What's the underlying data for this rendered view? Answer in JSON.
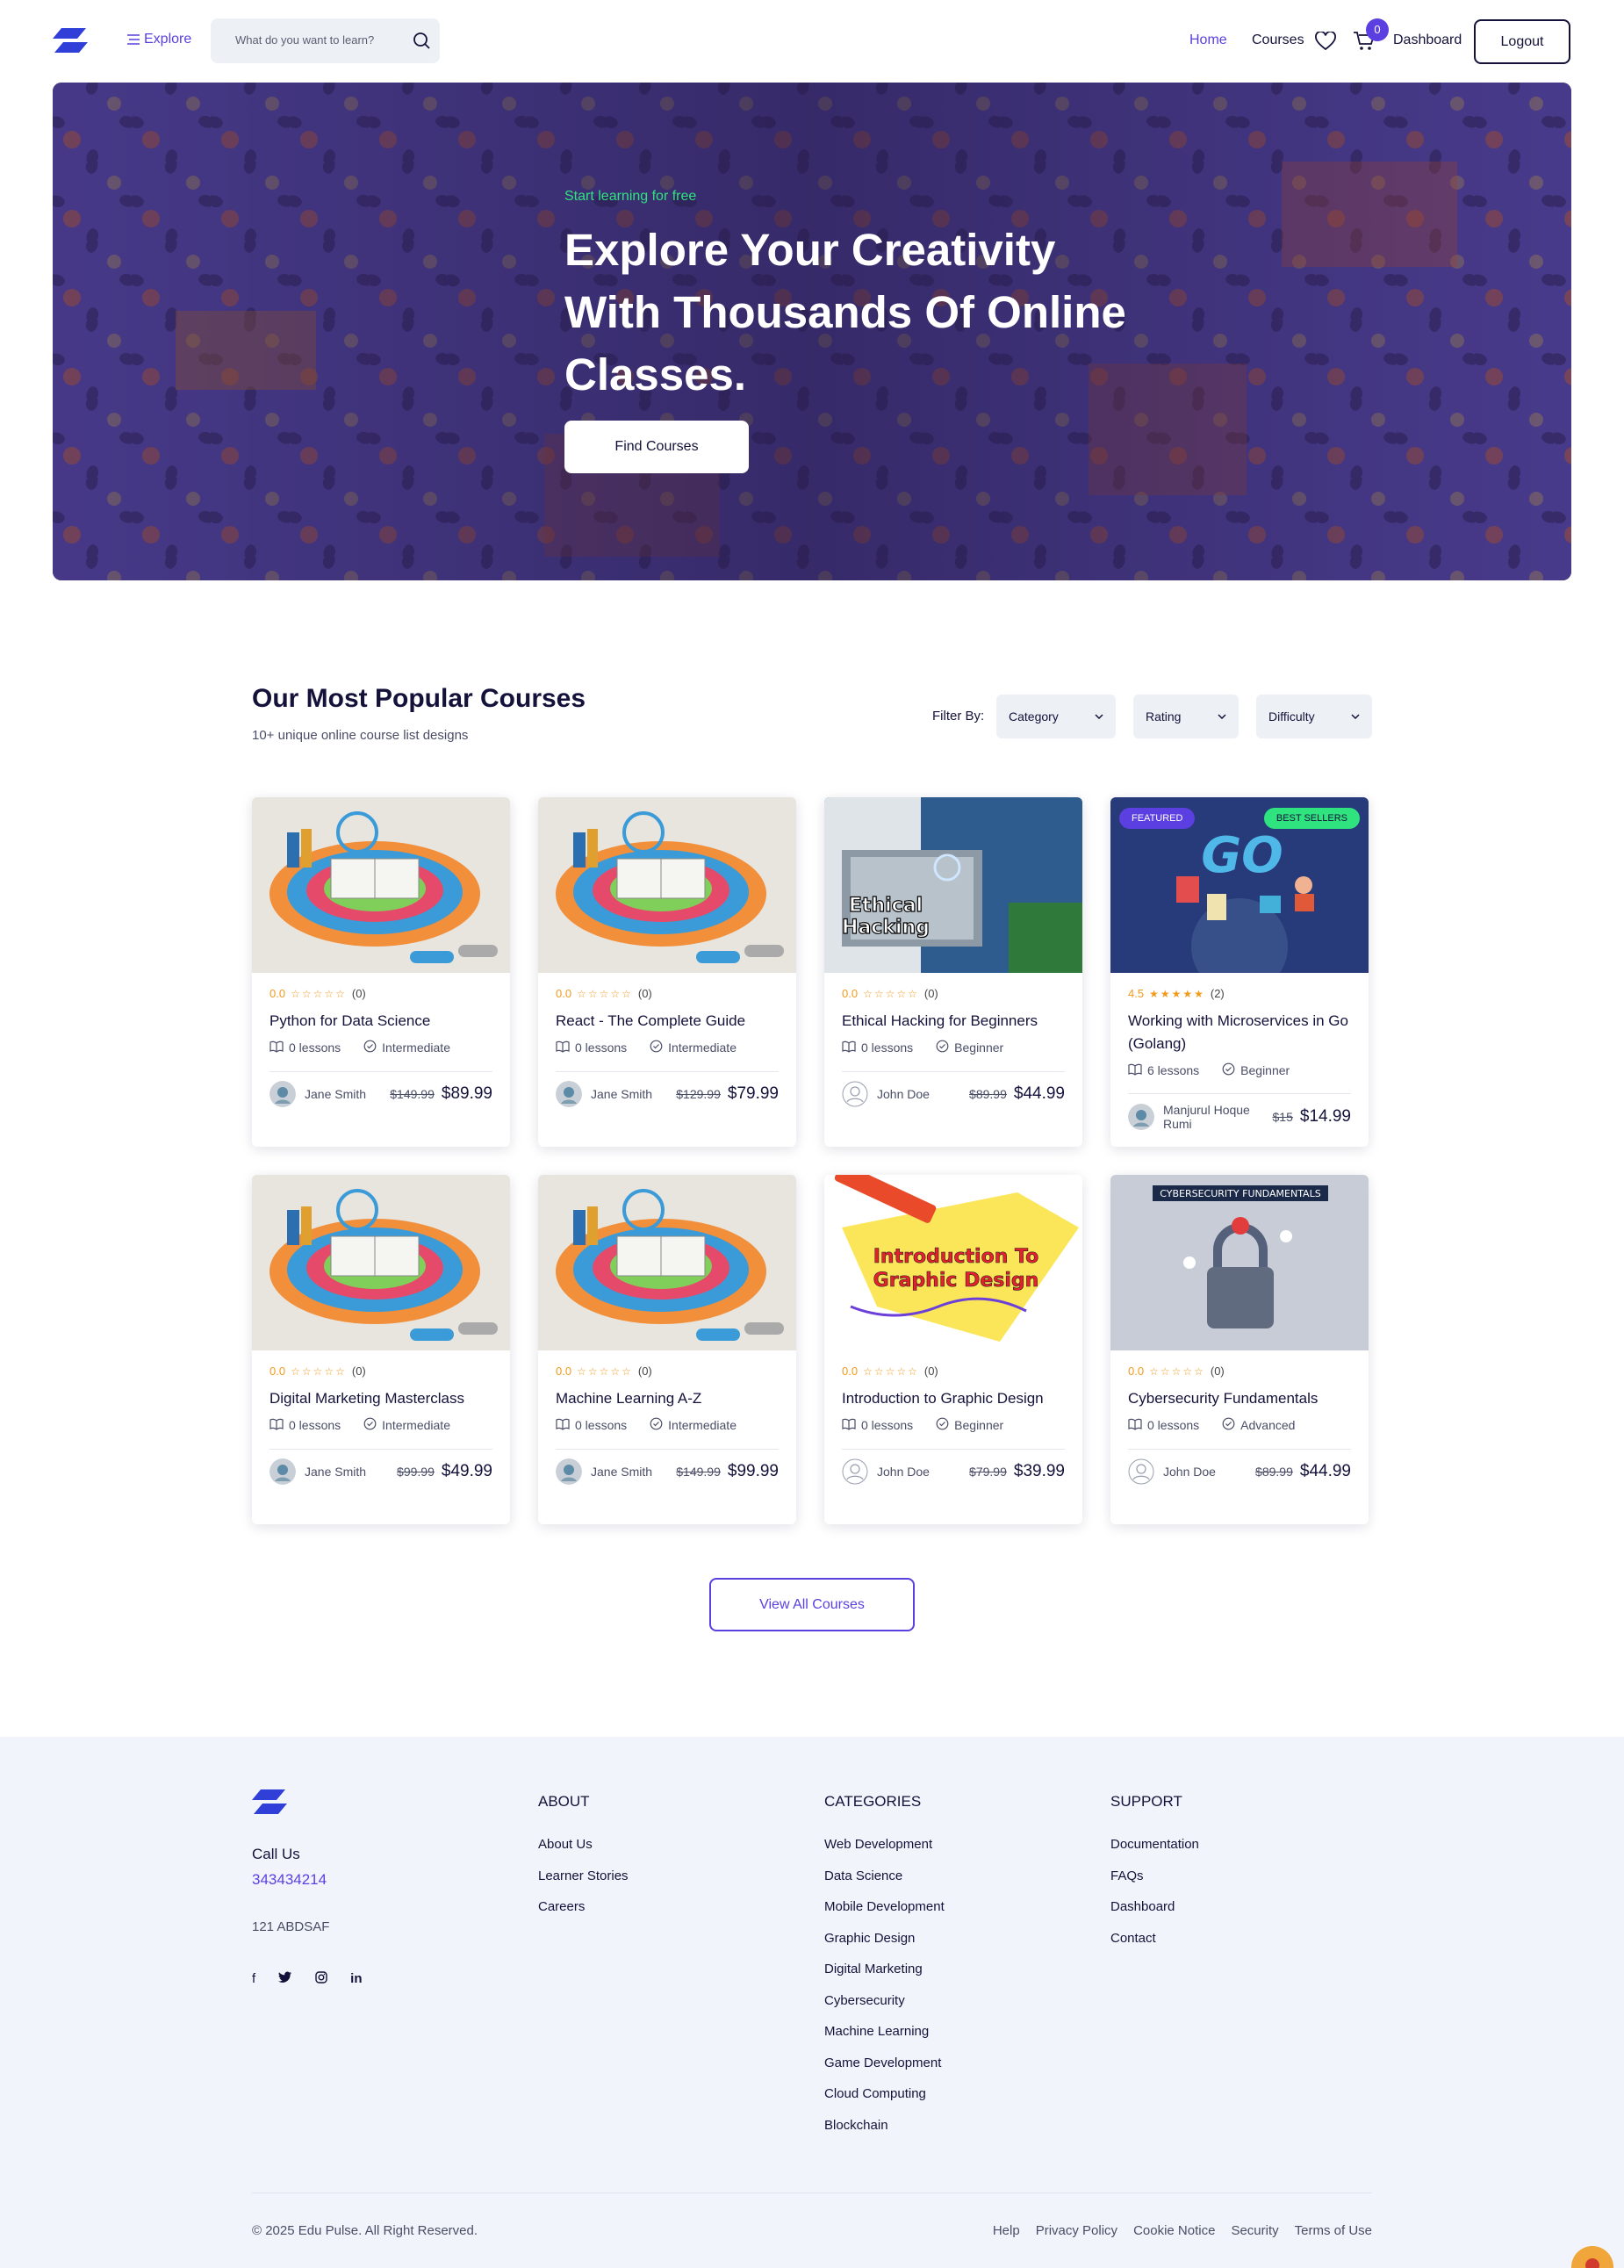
{
  "nav": {
    "explore_label": "Explore",
    "search_placeholder": "What do you want to learn?",
    "home_label": "Home",
    "courses_label": "Courses",
    "cart_count": "0",
    "dashboard_label": "Dashboard",
    "logout_label": "Logout"
  },
  "hero": {
    "tagline": "Start learning for free",
    "title": "Explore Your Creativity With Thousands Of Online Classes.",
    "cta": "Find Courses"
  },
  "popular": {
    "title": "Our Most Popular Courses",
    "subtitle": "10+ unique online course list designs",
    "filter_label": "Filter By:",
    "filters": [
      "Category",
      "Rating",
      "Difficulty"
    ],
    "view_all": "View All Courses"
  },
  "courses": [
    {
      "rating": "0.0",
      "rating_value": 0,
      "stars": "☆☆☆☆☆",
      "count": "(0)",
      "title": "Python for Data Science",
      "lessons": "0 lessons",
      "level": "Intermediate",
      "instructor": "Jane Smith",
      "old_price": "$149.99",
      "price": "$89.99",
      "image": "course-preview"
    },
    {
      "rating": "0.0",
      "rating_value": 0,
      "stars": "☆☆☆☆☆",
      "count": "(0)",
      "title": "React - The Complete Guide",
      "lessons": "0 lessons",
      "level": "Intermediate",
      "instructor": "Jane Smith",
      "old_price": "$129.99",
      "price": "$79.99",
      "image": "course-preview"
    },
    {
      "rating": "0.0",
      "rating_value": 0,
      "stars": "☆☆☆☆☆",
      "count": "(0)",
      "title": "Ethical Hacking for Beginners",
      "lessons": "0 lessons",
      "level": "Beginner",
      "instructor": "John Doe",
      "old_price": "$89.99",
      "price": "$44.99",
      "image": "ethical-hacking",
      "image_text": "Ethical Hacking"
    },
    {
      "rating": "4.5",
      "rating_value": 4.5,
      "stars": "★★★★★",
      "count": "(2)",
      "title": "Working with Microservices in Go (Golang)",
      "lessons": "6 lessons",
      "level": "Beginner",
      "instructor": "Manjurul Hoque Rumi",
      "old_price": "$15",
      "price": "$14.99",
      "image": "golang",
      "image_text": "GO",
      "badge_left": "FEATURED",
      "badge_right": "BEST SELLERS"
    },
    {
      "rating": "0.0",
      "rating_value": 0,
      "stars": "☆☆☆☆☆",
      "count": "(0)",
      "title": "Digital Marketing Masterclass",
      "lessons": "0 lessons",
      "level": "Intermediate",
      "instructor": "Jane Smith",
      "old_price": "$99.99",
      "price": "$49.99",
      "image": "course-preview"
    },
    {
      "rating": "0.0",
      "rating_value": 0,
      "stars": "☆☆☆☆☆",
      "count": "(0)",
      "title": "Machine Learning A-Z",
      "lessons": "0 lessons",
      "level": "Intermediate",
      "instructor": "Jane Smith",
      "old_price": "$149.99",
      "price": "$99.99",
      "image": "course-preview"
    },
    {
      "rating": "0.0",
      "rating_value": 0,
      "stars": "☆☆☆☆☆",
      "count": "(0)",
      "title": "Introduction to Graphic Design",
      "lessons": "0 lessons",
      "level": "Beginner",
      "instructor": "John Doe",
      "old_price": "$79.99",
      "price": "$39.99",
      "image": "graphic-design",
      "image_text": "Introduction To Graphic Design"
    },
    {
      "rating": "0.0",
      "rating_value": 0,
      "stars": "☆☆☆☆☆",
      "count": "(0)",
      "title": "Cybersecurity Fundamentals",
      "lessons": "0 lessons",
      "level": "Advanced",
      "instructor": "John Doe",
      "old_price": "$89.99",
      "price": "$44.99",
      "image": "cybersecurity",
      "image_text": "CYBERSECURITY FUNDAMENTALS"
    }
  ],
  "footer": {
    "call_label": "Call Us",
    "phone": "343434214",
    "address": "121 ABDSAF",
    "socials": [
      "facebook-icon",
      "twitter-icon",
      "instagram-icon",
      "linkedin-icon"
    ],
    "about_title": "ABOUT",
    "about_links": [
      "About Us",
      "Learner Stories",
      "Careers"
    ],
    "categories_title": "CATEGORIES",
    "categories_links": [
      "Web Development",
      "Data Science",
      "Mobile Development",
      "Graphic Design",
      "Digital Marketing",
      "Cybersecurity",
      "Machine Learning",
      "Game Development",
      "Cloud Computing",
      "Blockchain"
    ],
    "support_title": "SUPPORT",
    "support_links": [
      "Documentation",
      "FAQs",
      "Dashboard",
      "Contact"
    ],
    "copyright": "© 2025 Edu Pulse. All Right Reserved.",
    "bottom_links": [
      "Help",
      "Privacy Policy",
      "Cookie Notice",
      "Security",
      "Terms of Use"
    ]
  },
  "colors": {
    "primary": "#5b3fe0",
    "accent_green": "#2fe37f",
    "dark": "#14123a",
    "star": "#f29a1c"
  }
}
